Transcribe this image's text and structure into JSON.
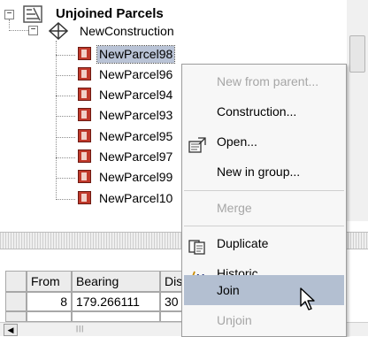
{
  "tree": {
    "root": {
      "label": "Unjoined Parcels",
      "expander": "−"
    },
    "construction": {
      "label": "NewConstruction",
      "expander": "−"
    },
    "parcels": [
      {
        "label": "NewParcel98",
        "selected": true
      },
      {
        "label": "NewParcel96",
        "selected": false
      },
      {
        "label": "NewParcel94",
        "selected": false
      },
      {
        "label": "NewParcel93",
        "selected": false
      },
      {
        "label": "NewParcel95",
        "selected": false
      },
      {
        "label": "NewParcel97",
        "selected": false
      },
      {
        "label": "NewParcel99",
        "selected": false
      },
      {
        "label": "NewParcel10",
        "selected": false
      }
    ]
  },
  "grid": {
    "columns": [
      "From",
      "Bearing",
      "Dis"
    ],
    "rows": [
      [
        "8",
        "179.266111",
        "30"
      ]
    ]
  },
  "context_menu": {
    "items": [
      {
        "label": "New from parent...",
        "enabled": false,
        "icon": ""
      },
      {
        "label": "Construction...",
        "enabled": true,
        "icon": ""
      },
      {
        "label": "Open...",
        "enabled": true,
        "icon": "open-icon"
      },
      {
        "label": "New in group...",
        "enabled": true,
        "icon": ""
      },
      {
        "label": "Merge",
        "enabled": false,
        "icon": ""
      },
      {
        "label": "Duplicate",
        "enabled": true,
        "icon": "duplicate-icon"
      },
      {
        "label": "Historic",
        "enabled": true,
        "icon": "historic-icon"
      },
      {
        "label": "Join",
        "enabled": true,
        "icon": "",
        "highlighted": true
      },
      {
        "label": "Unjoin",
        "enabled": false,
        "icon": ""
      }
    ]
  },
  "colors": {
    "selection": "#b9c3d6",
    "menu_highlight": "#b3bfd1",
    "parcel_icon": "#c0392b"
  }
}
